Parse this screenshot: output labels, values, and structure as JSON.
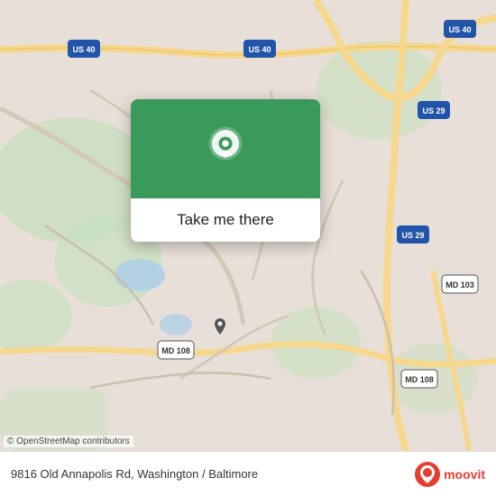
{
  "map": {
    "alt": "OpenStreetMap of Washington/Baltimore area",
    "credit": "© OpenStreetMap contributors",
    "popup": {
      "button_label": "Take me there"
    },
    "pin_icon": "location-pin",
    "arrow_icon": "popup-arrow"
  },
  "bottom_bar": {
    "address": "9816 Old Annapolis Rd, Washington / Baltimore",
    "logo_text": "moovit"
  }
}
